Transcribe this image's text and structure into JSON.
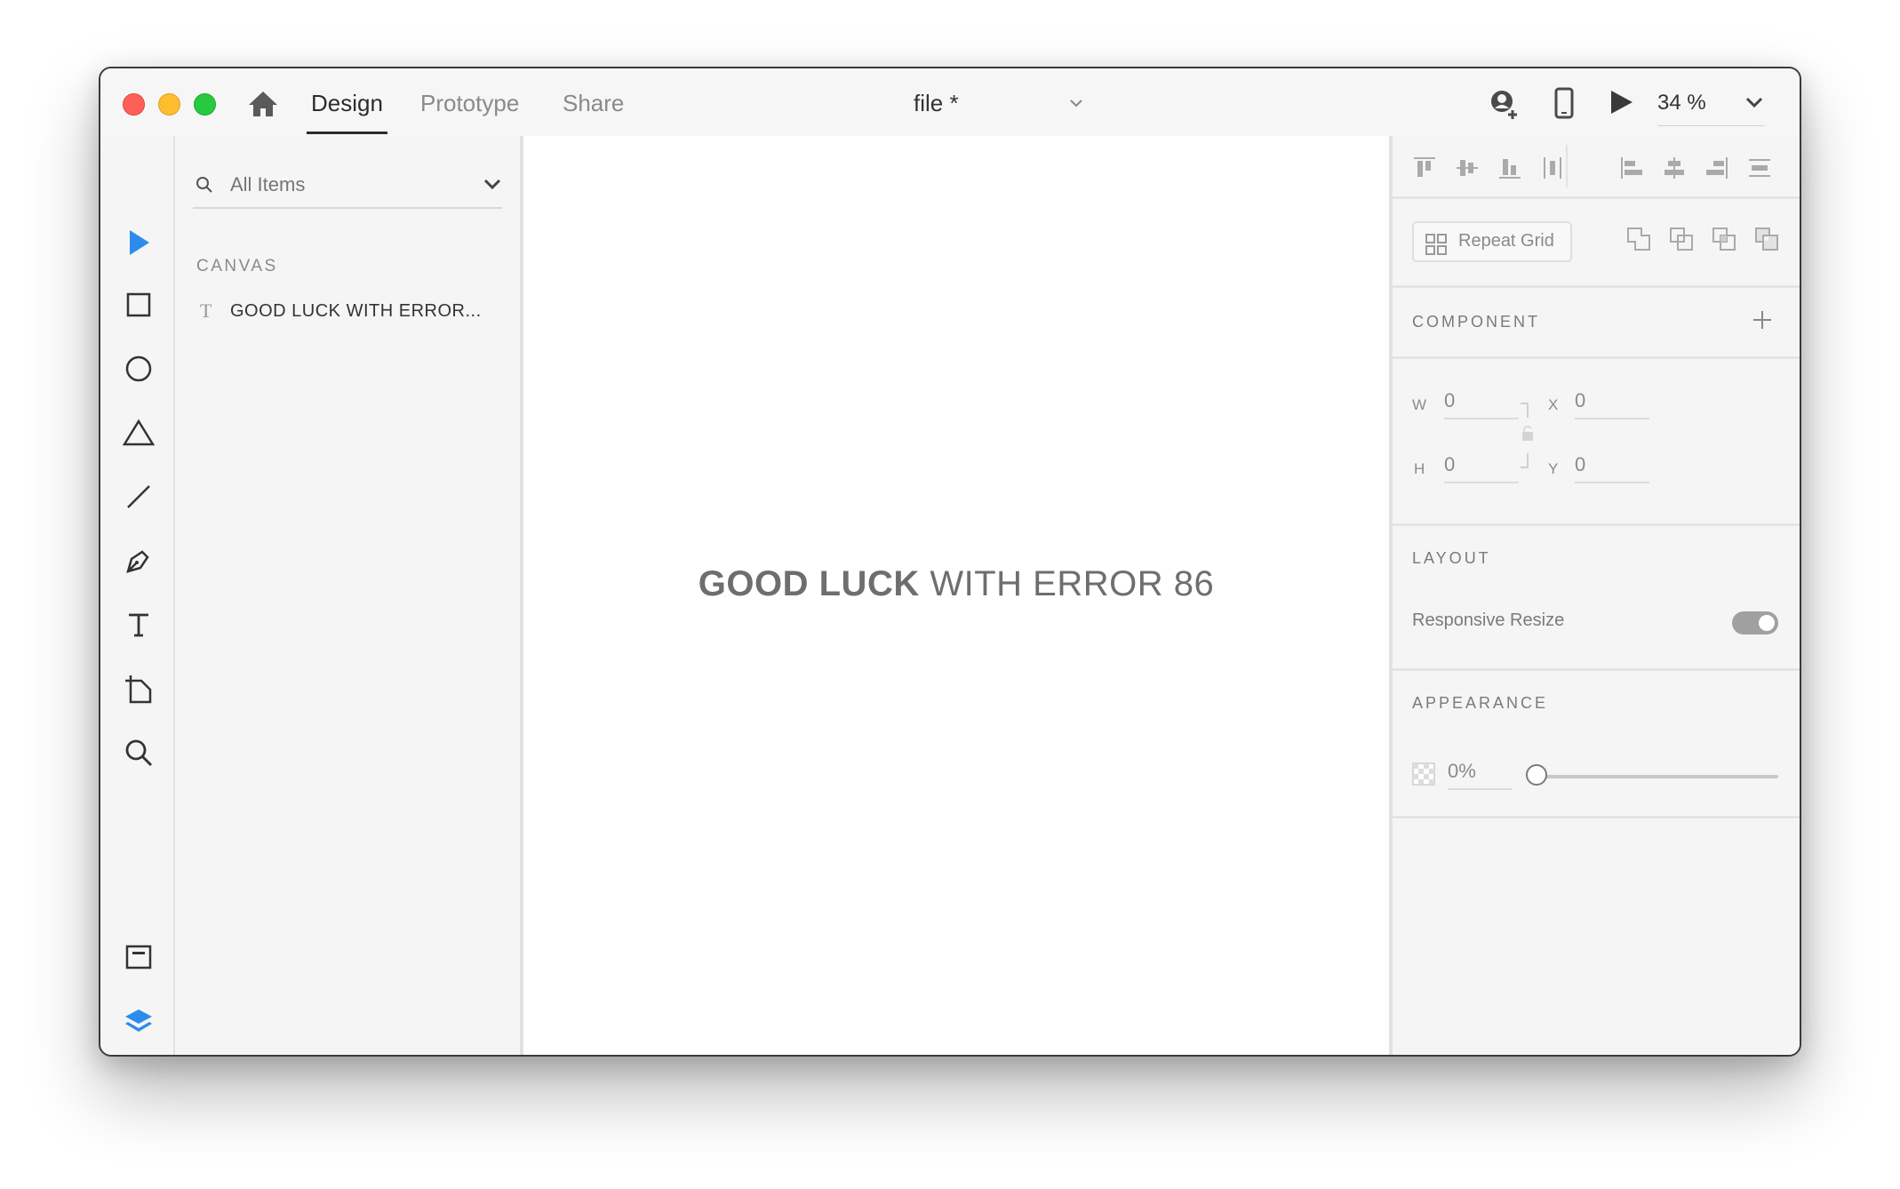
{
  "titlebar": {
    "tabs": [
      {
        "label": "Design",
        "active": true
      },
      {
        "label": "Prototype",
        "active": false
      },
      {
        "label": "Share",
        "active": false
      }
    ],
    "document_title": "file *",
    "zoom": "34 %"
  },
  "toolbar": {
    "tools": [
      "select-tool",
      "rectangle-tool",
      "ellipse-tool",
      "polygon-tool",
      "line-tool",
      "pen-tool",
      "text-tool",
      "artboard-tool",
      "zoom-tool"
    ],
    "bottom": [
      "assets-panel",
      "layers-panel",
      "plugins-panel"
    ],
    "accent_color": "#2d8ceb"
  },
  "layers": {
    "search_placeholder": "All Items",
    "section_heading": "CANVAS",
    "items": [
      {
        "type": "text",
        "icon_glyph": "T",
        "label": "GOOD LUCK WITH ERROR..."
      }
    ]
  },
  "canvas": {
    "text_bold": "GOOD LUCK",
    "text_regular": " WITH ERROR 86"
  },
  "properties": {
    "repeat_grid_label": "Repeat Grid",
    "component_heading": "COMPONENT",
    "dimensions": {
      "w_label": "W",
      "w_value": "0",
      "h_label": "H",
      "h_value": "0",
      "x_label": "X",
      "x_value": "0",
      "y_label": "Y",
      "y_value": "0"
    },
    "layout_heading": "LAYOUT",
    "responsive_resize_label": "Responsive Resize",
    "responsive_resize_on": true,
    "appearance_heading": "APPEARANCE",
    "opacity": "0%",
    "opacity_fraction": 0
  }
}
